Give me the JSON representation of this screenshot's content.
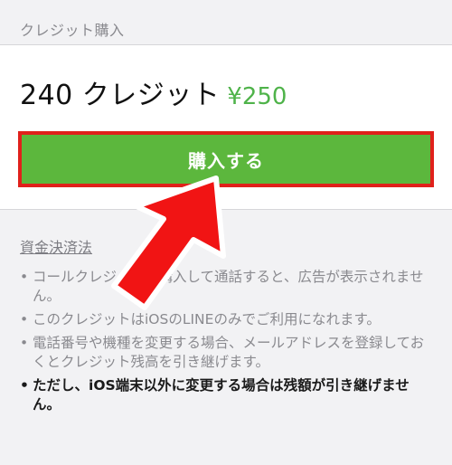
{
  "header": {
    "title": "クレジット購入"
  },
  "product": {
    "name": "240 クレジット",
    "price": "¥250"
  },
  "purchase": {
    "button_label": "購入する"
  },
  "info": {
    "law_link": "資金決済法",
    "notes": [
      "コールクレジットを購入して通話すると、広告が表示されません。",
      "このクレジットはiOSのLINEのみでご利用になれます。",
      "電話番号や機種を変更する場合、メールアドレスを登録しておくとクレジット残高を引き継げます。",
      "ただし、iOS端末以外に変更する場合は残額が引き継げません。"
    ]
  },
  "colors": {
    "accent_green": "#5cb73d",
    "price_green": "#4fb34a",
    "highlight_red": "#e0201b"
  },
  "annotation": {
    "icon": "red-arrow-icon"
  }
}
